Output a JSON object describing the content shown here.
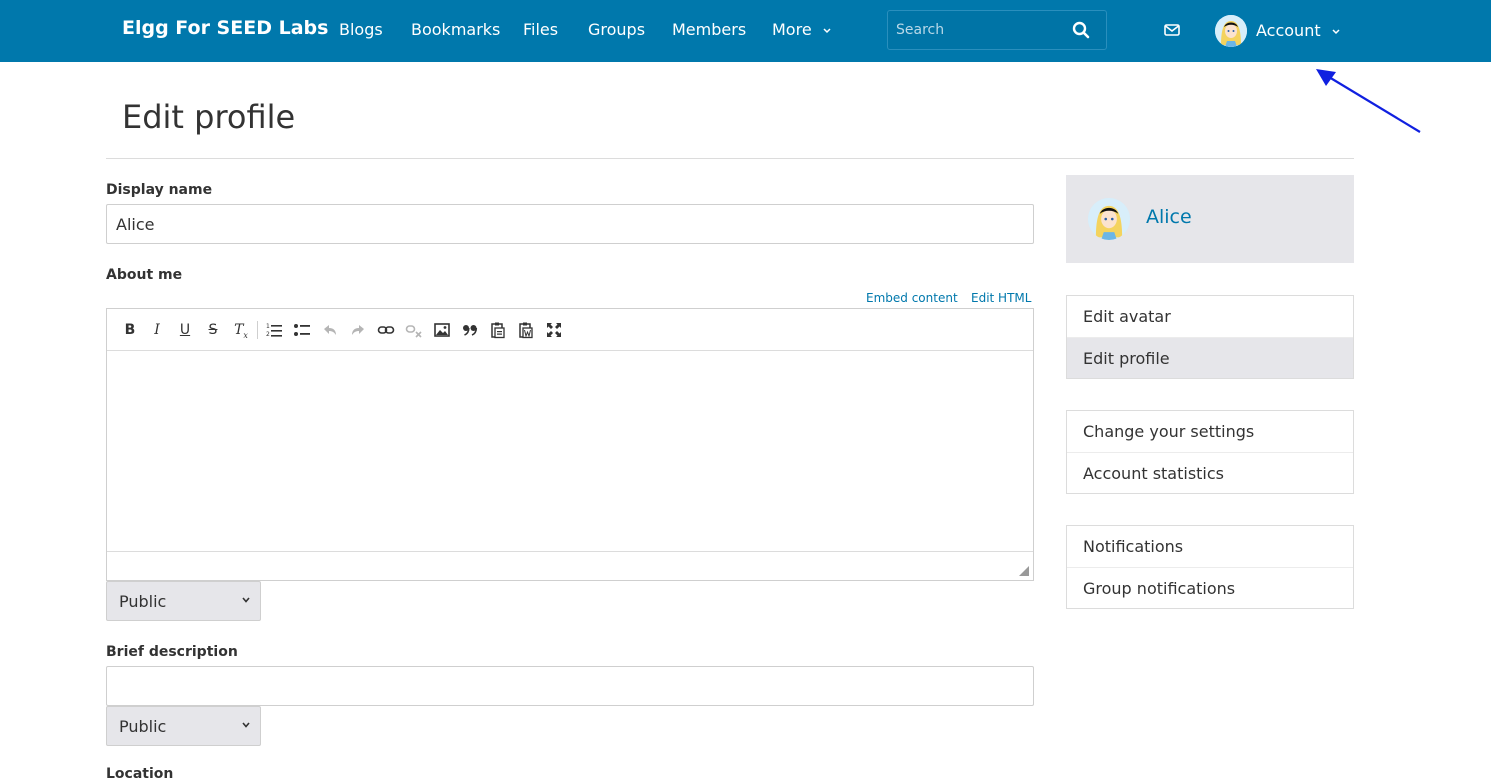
{
  "topbar": {
    "brand": "Elgg For SEED Labs",
    "nav": [
      "Blogs",
      "Bookmarks",
      "Files",
      "Groups",
      "Members",
      "More"
    ],
    "search_placeholder": "Search",
    "account_label": "Account",
    "bg_color": "#0078ac"
  },
  "page": {
    "title": "Edit profile"
  },
  "form": {
    "display_name_label": "Display name",
    "display_name_value": "Alice",
    "about_me_label": "About me",
    "embed_content": "Embed content",
    "edit_html": "Edit HTML",
    "about_me_access": "Public",
    "brief_description_label": "Brief description",
    "brief_description_value": "",
    "brief_description_access": "Public",
    "location_label": "Location"
  },
  "editor_toolbar": {
    "icons": [
      "bold-icon",
      "italic-icon",
      "underline-icon",
      "strikethrough-icon",
      "remove-format-icon",
      "numbered-list-icon",
      "bulleted-list-icon",
      "undo-icon",
      "redo-icon",
      "link-icon",
      "unlink-icon",
      "image-icon",
      "blockquote-icon",
      "paste-text-icon",
      "paste-word-icon",
      "maximize-icon"
    ]
  },
  "sidebar": {
    "owner_name": "Alice",
    "menu1": [
      "Edit avatar",
      "Edit profile"
    ],
    "menu2": [
      "Change your settings",
      "Account statistics"
    ],
    "menu3": [
      "Notifications",
      "Group notifications"
    ],
    "selected": "Edit profile"
  }
}
